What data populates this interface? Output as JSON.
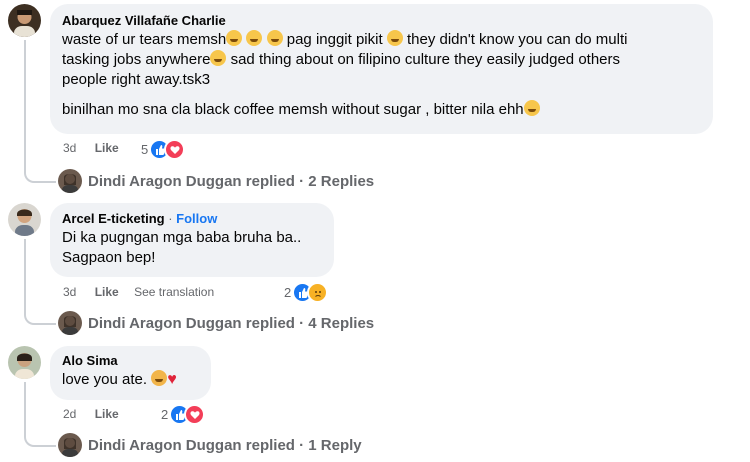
{
  "comments": [
    {
      "author": "Abarquez Villafañe Charlie",
      "line1a": "waste of ur tears memsh",
      "line1b": " pag inggit pikit ",
      "line1c": " they didn't know you can do multi",
      "line2a": "tasking jobs anywhere",
      "line2b": " sad thing about on filipino culture they easily judged others",
      "line3": "people right away.tsk3",
      "line4": "binilhan mo sna cla black coffee memsh without sugar , bitter nila ehh",
      "time": "3d",
      "like": "Like",
      "reaction_count": "5",
      "reactions": [
        "like-icon",
        "love-icon"
      ],
      "replies": "Dindi Aragon Duggan replied · 2 Replies"
    },
    {
      "author": "Arcel E-ticketing",
      "follow": "Follow",
      "line1": "Di ka pugngan mga baba bruha ba..",
      "line2": "Sagpaon bep!",
      "time": "3d",
      "like": "Like",
      "translation": "See translation",
      "reaction_count": "2",
      "reactions": [
        "like-icon",
        "sad-icon"
      ],
      "replies": "Dindi Aragon Duggan replied · 4 Replies"
    },
    {
      "author": "Alo Sima",
      "line1": "love you ate. ",
      "time": "2d",
      "like": "Like",
      "reaction_count": "2",
      "reactions": [
        "like-icon",
        "love-icon"
      ],
      "replies": "Dindi Aragon Duggan replied · 1 Reply"
    }
  ],
  "colors": {
    "like": "#1877f2",
    "love": "#f33e58",
    "sad": "#f7b125",
    "muted": "#65676b",
    "bubble": "#f0f2f5"
  }
}
